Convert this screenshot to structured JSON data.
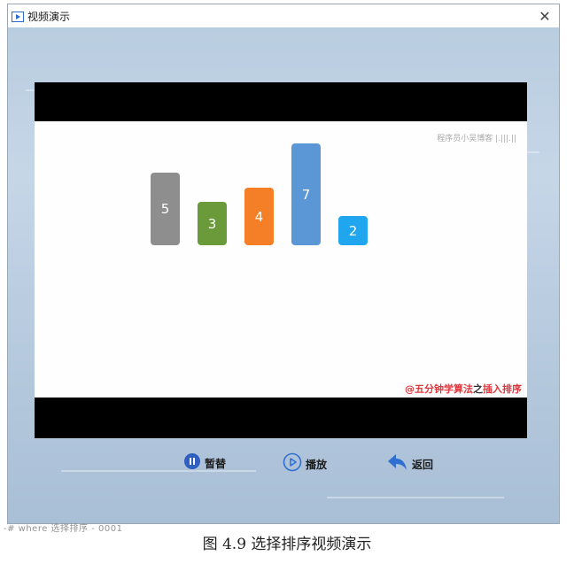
{
  "window": {
    "title": "视频演示",
    "close_glyph": "✕"
  },
  "video": {
    "watermark": "程序员小吴博客 |.|||.||",
    "bars": [
      {
        "value": "5",
        "color": "#8e8e8e"
      },
      {
        "value": "3",
        "color": "#6a9a3a"
      },
      {
        "value": "4",
        "color": "#f57f27"
      },
      {
        "value": "7",
        "color": "#5b97d6"
      },
      {
        "value": "2",
        "color": "#20a6ee"
      }
    ],
    "credit": {
      "prefix": "@五分钟学算法",
      "middle": "之",
      "suffix": "插入排序"
    }
  },
  "controls": {
    "pause_label": "暂替",
    "play_label": "播放",
    "back_label": "返回",
    "accent_color": "#2f5fbf"
  },
  "below_window_text": "-# where 选择排序 - 0001",
  "figure_caption": "图 4.9  选择排序视频演示"
}
